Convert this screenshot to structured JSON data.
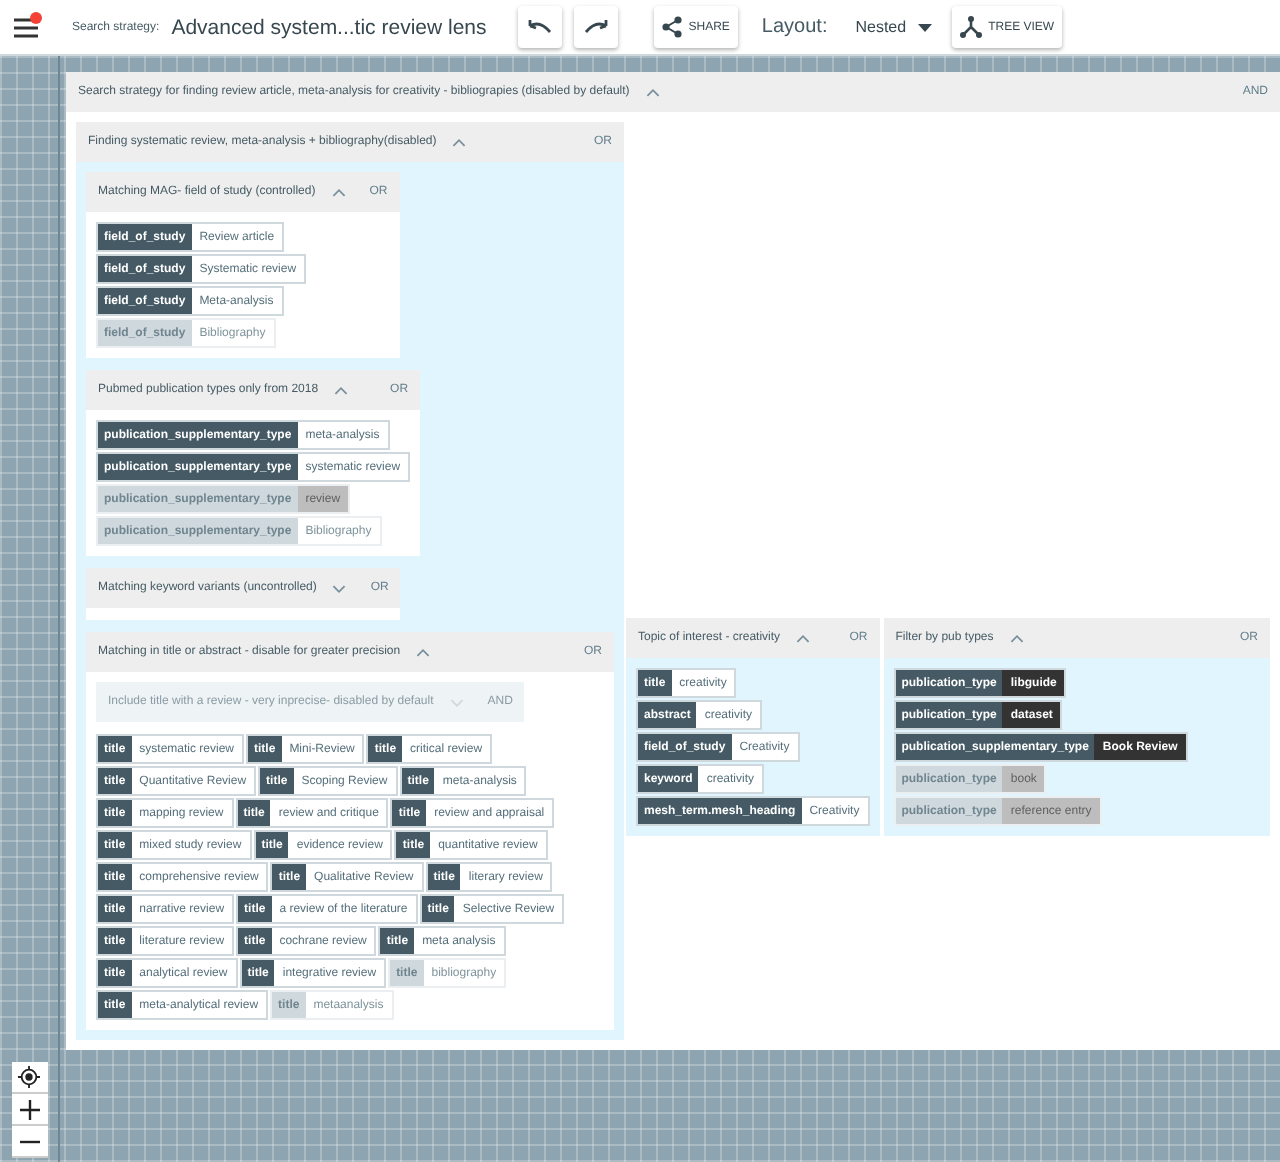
{
  "toolbar": {
    "label": "Search strategy:",
    "title": "Advanced system...tic review lens",
    "share": "SHARE",
    "layout_label": "Layout:",
    "layout_value": "Nested",
    "tree_view": "TREE VIEW",
    "has_notification": true
  },
  "strategy": {
    "title": "Search strategy for finding review article, meta-analysis for creativity -  bibliograpies (disabled by default)",
    "operator": "AND",
    "expanded": true,
    "disabled": false,
    "groups": [
      {
        "title": "Finding systematic review, meta-analysis + bibliography(disabled)",
        "operator": "OR",
        "expanded": true,
        "disabled": false,
        "groups": [
          {
            "title": "Matching MAG- field of study (controlled)",
            "operator": "OR",
            "expanded": true,
            "disabled": false,
            "terms": [
              {
                "field": "field_of_study",
                "value": "Review article",
                "kind": "match",
                "disabled": false
              },
              {
                "field": "field_of_study",
                "value": "Systematic review",
                "kind": "match",
                "disabled": false
              },
              {
                "field": "field_of_study",
                "value": "Meta-analysis",
                "kind": "match",
                "disabled": false
              },
              {
                "field": "field_of_study",
                "value": "Bibliography",
                "kind": "match",
                "disabled": true
              }
            ]
          },
          {
            "title": "Pubmed publication types only from 2018",
            "operator": "OR",
            "expanded": true,
            "disabled": false,
            "terms": [
              {
                "field": "publication_supplementary_type",
                "value": "meta-analysis",
                "kind": "match",
                "disabled": false
              },
              {
                "field": "publication_supplementary_type",
                "value": "systematic review",
                "kind": "match",
                "disabled": false
              },
              {
                "field": "publication_supplementary_type",
                "value": "review",
                "kind": "filter",
                "disabled": true
              },
              {
                "field": "publication_supplementary_type",
                "value": "Bibliography",
                "kind": "match",
                "disabled": true
              }
            ]
          },
          {
            "title": "Matching keyword variants (uncontrolled)",
            "operator": "OR",
            "expanded": false,
            "disabled": false
          },
          {
            "title": "Matching in title or abstract - disable for greater precision",
            "operator": "OR",
            "expanded": true,
            "disabled": false,
            "wrap": true,
            "groups": [
              {
                "title": "Include title with a review  - very inprecise- disabled by default",
                "operator": "AND",
                "expanded": false,
                "disabled": true
              }
            ],
            "terms": [
              {
                "field": "title",
                "value": "systematic review",
                "kind": "match",
                "disabled": false
              },
              {
                "field": "title",
                "value": "Mini-Review",
                "kind": "match",
                "disabled": false
              },
              {
                "field": "title",
                "value": "critical review",
                "kind": "match",
                "disabled": false
              },
              {
                "field": "title",
                "value": "Quantitative Review",
                "kind": "match",
                "disabled": false
              },
              {
                "field": "title",
                "value": "Scoping Review",
                "kind": "match",
                "disabled": false
              },
              {
                "field": "title",
                "value": "meta-analysis",
                "kind": "match",
                "disabled": false
              },
              {
                "field": "title",
                "value": "mapping review",
                "kind": "match",
                "disabled": false
              },
              {
                "field": "title",
                "value": "review and critique",
                "kind": "match",
                "disabled": false
              },
              {
                "field": "title",
                "value": "review and appraisal",
                "kind": "match",
                "disabled": false
              },
              {
                "field": "title",
                "value": "mixed study review",
                "kind": "match",
                "disabled": false
              },
              {
                "field": "title",
                "value": "evidence review",
                "kind": "match",
                "disabled": false
              },
              {
                "field": "title",
                "value": "quantitative review",
                "kind": "match",
                "disabled": false
              },
              {
                "field": "title",
                "value": "comprehensive review",
                "kind": "match",
                "disabled": false
              },
              {
                "field": "title",
                "value": "Qualitative Review",
                "kind": "match",
                "disabled": false
              },
              {
                "field": "title",
                "value": "literary review",
                "kind": "match",
                "disabled": false
              },
              {
                "field": "title",
                "value": "narrative review",
                "kind": "match",
                "disabled": false
              },
              {
                "field": "title",
                "value": "a review of the literature",
                "kind": "match",
                "disabled": false
              },
              {
                "field": "title",
                "value": "Selective Review",
                "kind": "match",
                "disabled": false
              },
              {
                "field": "title",
                "value": "literature review",
                "kind": "match",
                "disabled": false
              },
              {
                "field": "title",
                "value": "cochrane review",
                "kind": "match",
                "disabled": false
              },
              {
                "field": "title",
                "value": "meta analysis",
                "kind": "match",
                "disabled": false
              },
              {
                "field": "title",
                "value": "analytical review",
                "kind": "match",
                "disabled": false
              },
              {
                "field": "title",
                "value": "integrative review",
                "kind": "match",
                "disabled": false
              },
              {
                "field": "title",
                "value": "bibliography",
                "kind": "match",
                "disabled": true
              },
              {
                "field": "title",
                "value": "meta-analytical review",
                "kind": "match",
                "disabled": false
              },
              {
                "field": "title",
                "value": "metaanalysis",
                "kind": "match",
                "disabled": true
              }
            ]
          }
        ]
      },
      {
        "title": "Topic of interest - creativity",
        "operator": "OR",
        "expanded": true,
        "disabled": false,
        "terms": [
          {
            "field": "title",
            "value": "creativity",
            "kind": "match",
            "disabled": false
          },
          {
            "field": "abstract",
            "value": "creativity",
            "kind": "match",
            "disabled": false
          },
          {
            "field": "field_of_study",
            "value": "Creativity",
            "kind": "match",
            "disabled": false
          },
          {
            "field": "keyword",
            "value": "creativity",
            "kind": "match",
            "disabled": false
          },
          {
            "field": "mesh_term.mesh_heading",
            "value": "Creativity",
            "kind": "match",
            "disabled": false
          }
        ]
      },
      {
        "title": "Filter by pub types",
        "operator": "OR",
        "expanded": true,
        "disabled": false,
        "terms": [
          {
            "field": "publication_type",
            "value": "libguide",
            "kind": "filter",
            "disabled": false
          },
          {
            "field": "publication_type",
            "value": "dataset",
            "kind": "filter",
            "disabled": false
          },
          {
            "field": "publication_supplementary_type",
            "value": "Book Review",
            "kind": "filter",
            "disabled": false
          },
          {
            "field": "publication_type",
            "value": "book",
            "kind": "filter",
            "disabled": true
          },
          {
            "field": "publication_type",
            "value": "reference entry",
            "kind": "filter",
            "disabled": true
          }
        ]
      }
    ]
  }
}
